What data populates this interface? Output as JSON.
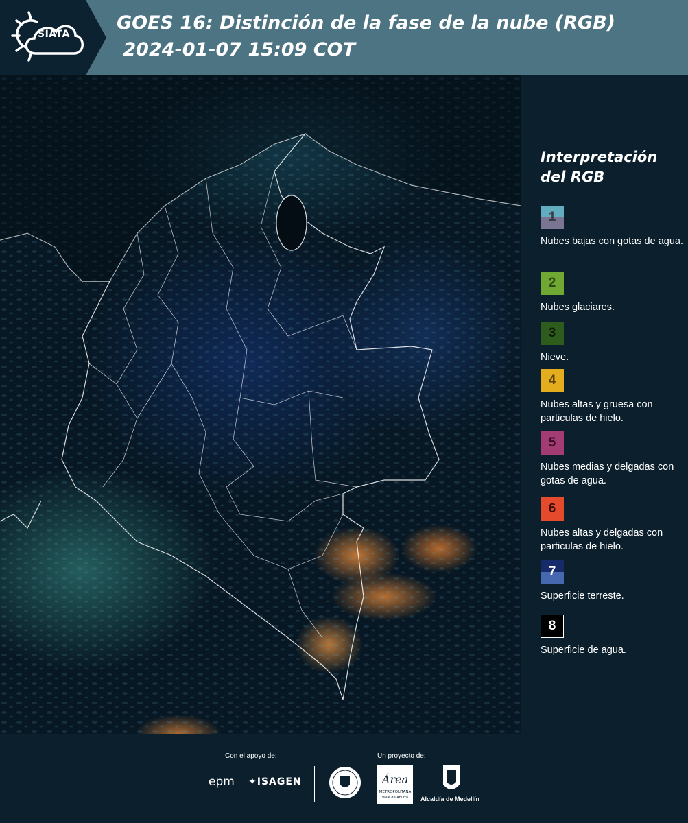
{
  "header": {
    "logo_name": "SIATA",
    "title_line1": "GOES 16: Distinción de la fase de la nube (RGB)",
    "title_line2": " 2024-01-07 15:09 COT"
  },
  "legend": {
    "title_line1": "Interpretación",
    "title_line2": "del RGB",
    "items": [
      {
        "number": "1",
        "label": "Nubes bajas con gotas de agua.",
        "color_top": "#62aec0",
        "color_bottom": "#7b7493",
        "text_color": "#3a3a45"
      },
      {
        "number": "2",
        "label": "Nubes glaciares.",
        "color": "#6fa832",
        "text_color": "#2d4a12"
      },
      {
        "number": "3",
        "label": "Nieve.",
        "color": "#2e5c1c",
        "text_color": "#0d1a08"
      },
      {
        "number": "4",
        "label": "Nubes altas y gruesa con particulas de hielo.",
        "color": "#e4ad1e",
        "text_color": "#5a4208"
      },
      {
        "number": "5",
        "label": "Nubes medias y delgadas con gotas de agua.",
        "color": "#a23c72",
        "text_color": "#3b0f28"
      },
      {
        "number": "6",
        "label": "Nubes altas y delgadas con particulas de hielo.",
        "color": "#e54a2c",
        "text_color": "#3d0f06"
      },
      {
        "number": "7",
        "label": "Superficie terreste.",
        "color_top": "#172a6a",
        "color_bottom": "#4568b0",
        "text_color": "#ffffff"
      },
      {
        "number": "8",
        "label": "Superficie de agua.",
        "color": "#000000",
        "border": "#ffffff",
        "text_color": "#ffffff"
      }
    ]
  },
  "footer": {
    "support_label": "Con el apoyo de:",
    "project_label": "Un proyecto de:",
    "epm": "epm",
    "isagen": "ISAGEN",
    "amva_word": "Área",
    "amva_sub1": "METROPOLITANA",
    "amva_sub2": "Valle de Aburrá",
    "alcaldia": "Alcaldía de Medellín"
  }
}
